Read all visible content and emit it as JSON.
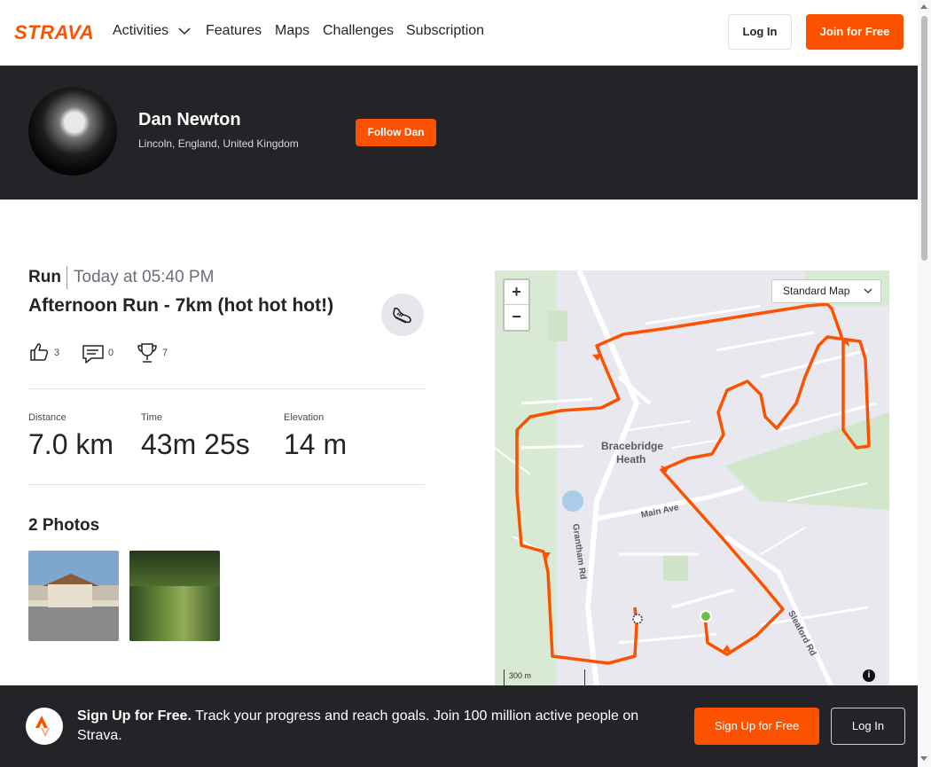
{
  "nav": {
    "logo_text": "STRAVA",
    "links": [
      "Activities",
      "Features",
      "Maps",
      "Challenges",
      "Subscription"
    ],
    "login": "Log In",
    "join": "Join for Free"
  },
  "athlete": {
    "name": "Dan Newton",
    "location": "Lincoln, England, United Kingdom",
    "follow": "Follow Dan"
  },
  "activity": {
    "type": "Run",
    "date": "Today at 05:40 PM",
    "title": "Afternoon Run - 7km (hot hot hot!)",
    "kudos": "3",
    "comments": "0",
    "achievements": "7",
    "stats": [
      {
        "label": "Distance",
        "value": "7.0 km"
      },
      {
        "label": "Time",
        "value": "43m 25s"
      },
      {
        "label": "Elevation",
        "value": "14 m"
      }
    ],
    "photos_heading": "2 Photos"
  },
  "map": {
    "zoom_in": "+",
    "zoom_out": "−",
    "map_type": "Standard Map",
    "place_label_1": "Bracebridge",
    "place_label_2": "Heath",
    "road_1": "Grantham Rd",
    "road_2": "Main Ave",
    "road_3": "Sleaford Rd",
    "scale": "300 m",
    "info": "i",
    "route_color": "#fc5200"
  },
  "signup": {
    "bold": "Sign Up for Free.",
    "text": " Track your progress and reach goals. Join 100 million active people on Strava.",
    "signup_button": "Sign Up for Free",
    "login_button": "Log In"
  },
  "colors": {
    "brand": "#fc5200",
    "banner": "#242428"
  }
}
